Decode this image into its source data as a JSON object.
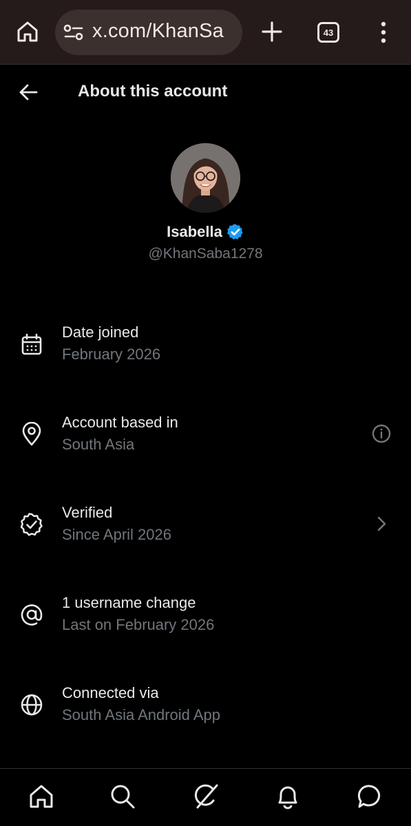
{
  "browser": {
    "url": "x.com/KhanSa",
    "tab_count": "43",
    "icons": [
      "home-icon",
      "site-settings-icon",
      "plus-icon",
      "tabs-icon",
      "more-vertical-icon"
    ]
  },
  "header": {
    "title": "About this account",
    "back_icon": "arrow-left-icon"
  },
  "profile": {
    "display_name": "Isabella",
    "handle": "@KhanSaba1278",
    "verified": true,
    "verified_color": "#1d9bf0"
  },
  "info": {
    "items": [
      {
        "icon": "calendar-icon",
        "label": "Date joined",
        "value": "February 2026"
      },
      {
        "icon": "location-pin-icon",
        "label": "Account based in",
        "value": "South Asia",
        "action_icon": "info-icon"
      },
      {
        "icon": "verified-badge-outline-icon",
        "label": "Verified",
        "value": "Since April 2026",
        "action_icon": "chevron-right-icon"
      },
      {
        "icon": "at-icon",
        "label": "1 username change",
        "value": "Last on February 2026"
      },
      {
        "icon": "globe-icon",
        "label": "Connected via",
        "value": "South Asia Android App"
      }
    ]
  },
  "bottom_nav": {
    "items": [
      "home-icon",
      "search-icon",
      "grok-icon",
      "bell-icon",
      "messages-icon"
    ]
  },
  "colors": {
    "background": "#000000",
    "primary_text": "#e7e9ea",
    "secondary_text": "#71767b",
    "browser_bar": "#241b1a",
    "url_pill": "#3b302e"
  }
}
